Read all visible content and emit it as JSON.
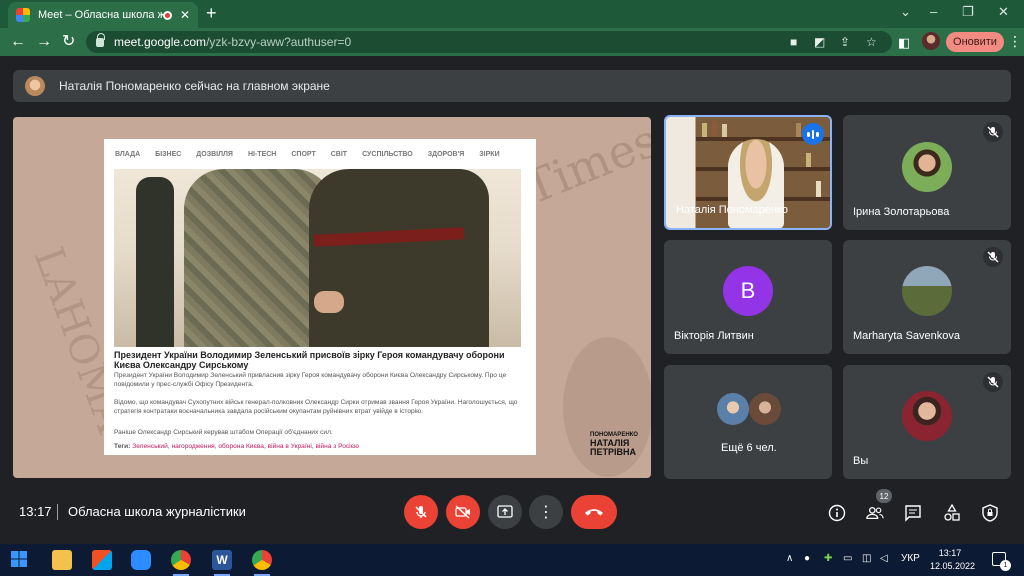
{
  "browser": {
    "tab_title": "Meet – Обласна школа жур",
    "tab_close": "✕",
    "new_tab": "+",
    "url_host": "meet.google.com",
    "url_path": "/yzk-bzvy-aww?authuser=0",
    "update_button": "Оновити",
    "window_controls": [
      "⌄",
      "–",
      "❐",
      "✕"
    ]
  },
  "banner": {
    "text": "Наталія Пономаренко сейчас на главном экране"
  },
  "article": {
    "categories": [
      "ВЛАДА",
      "БІЗНЕС",
      "ДОЗВІЛЛЯ",
      "HI-TECH",
      "СПОРТ",
      "СВІТ",
      "СУСПІЛЬСТВО",
      "ЗДОРОВ'Я",
      "ЗІРКИ"
    ],
    "headline": "Президент України Володимир Зеленський присвоїв зірку Героя командувачу оборони Києва Олександру Сирському",
    "paragraphs": [
      "Президент України Володимир Зеленський привласнив зірку Героя командувачу оборони Києва Олександру Сирському. Про це повідомили у прес-службі Офісу Президента.",
      "Відомо, що командувач Сухопутних військ генерал-полковник Олександр Сирки отримав звання Героя України. Наголошується, що стратегія контратаки воєначальника завдала російським окупантам руйнівних втрат увійде в історію.",
      "Раніше Олександр Сирський керував штабом Операції об'єднаних сил."
    ],
    "tags_label": "Теги:",
    "tags": [
      "Зеленський",
      "нагородження",
      "оборона Києва",
      "війна в Україні",
      "війна з Росією"
    ],
    "logo_small": "ПОНОМАРЕНКО",
    "logo_line1": "НАТАЛІЯ",
    "logo_line2": "ПЕТРІВНА"
  },
  "participants": [
    {
      "name": "Наталія Пономаренко",
      "speaking": true
    },
    {
      "name": "Ірина Золотарьова",
      "muted": true
    },
    {
      "name": "Вікторія Литвин",
      "initial": "B",
      "color": "#9334e6"
    },
    {
      "name": "Marharyta Savenkova",
      "muted": true
    },
    {
      "name": "Ещё 6 чел."
    },
    {
      "name": "Вы",
      "muted": true
    }
  ],
  "controls": {
    "time": "13:17",
    "meeting_title": "Обласна школа журналістики",
    "people_count": "12"
  },
  "taskbar": {
    "language": "УКР",
    "time": "13:17",
    "date": "12.05.2022",
    "notifications": "1"
  },
  "colors": {
    "chrome_green": "#2b6e47",
    "meet_bg": "#202124",
    "red": "#ea4335",
    "accent_blue": "#8ab4f8"
  }
}
